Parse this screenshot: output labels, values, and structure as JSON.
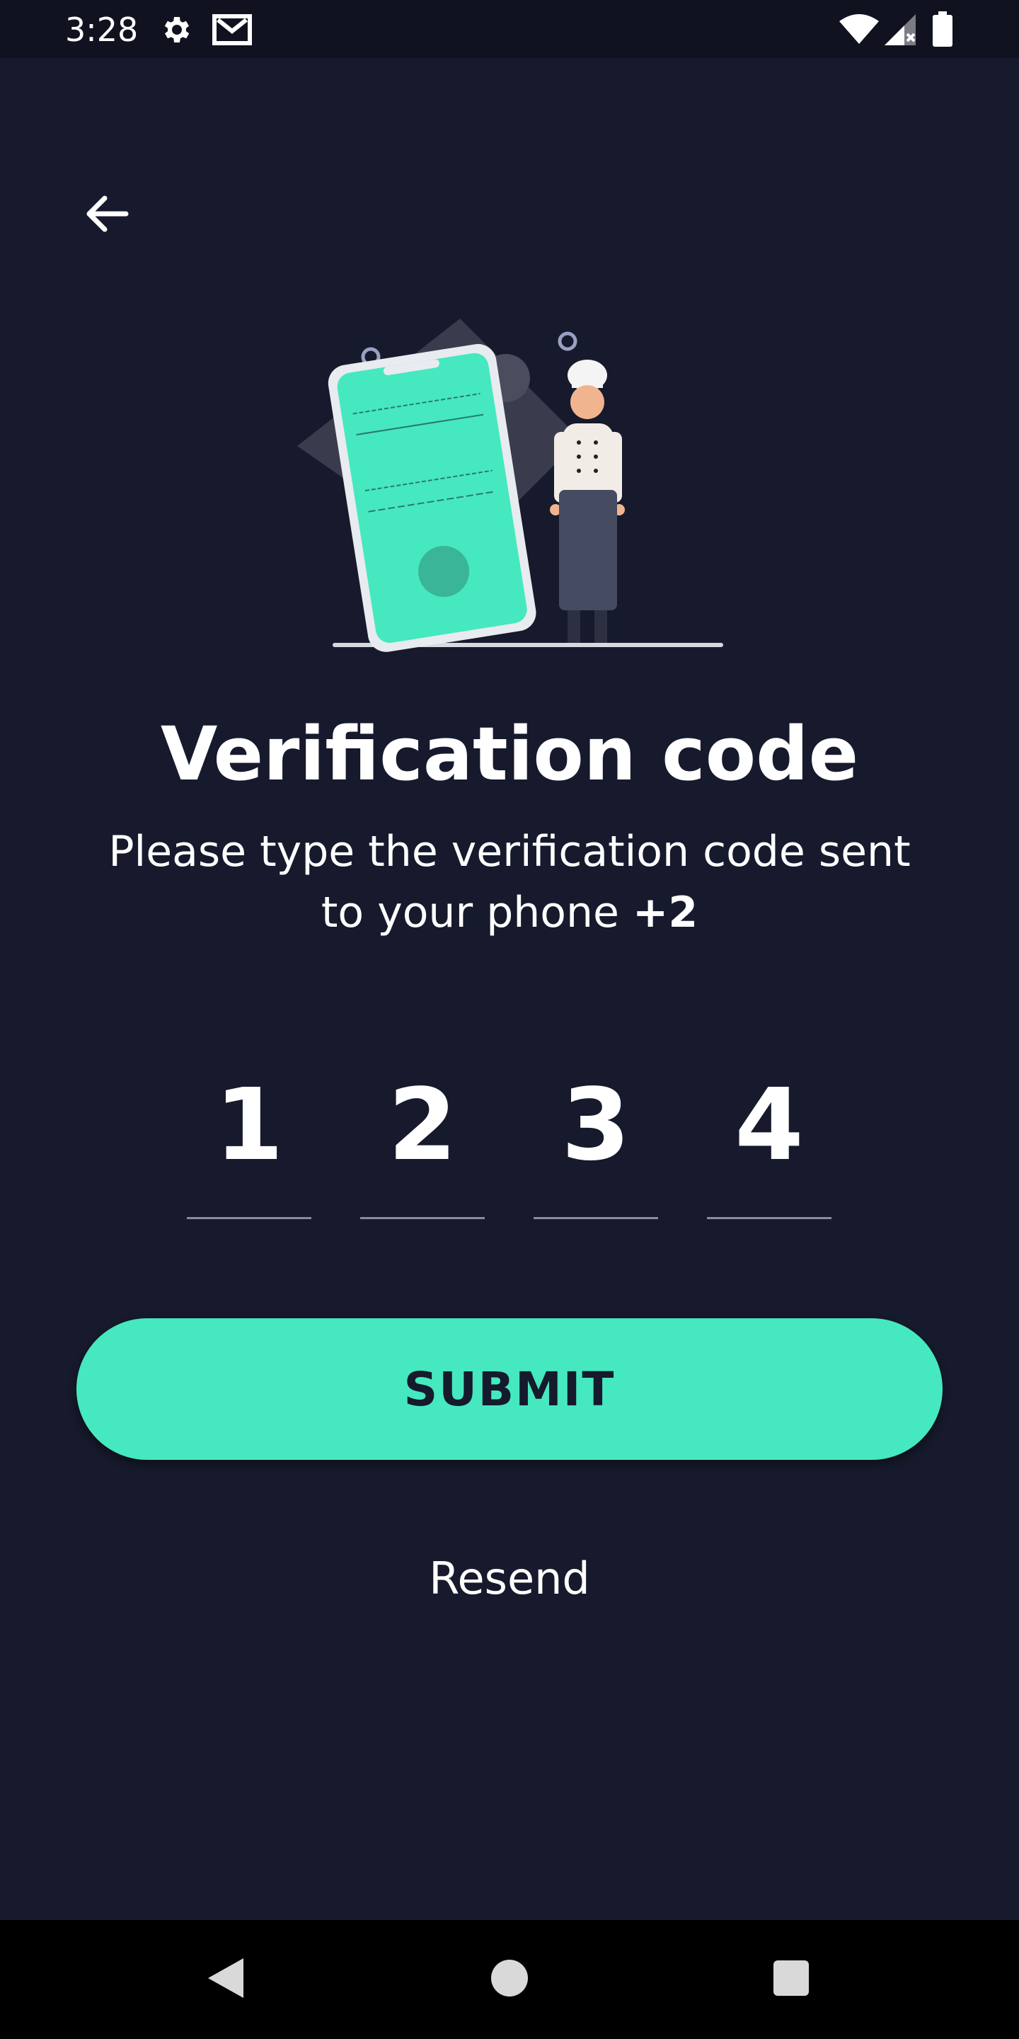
{
  "status_bar": {
    "time": "3:28",
    "icons": [
      "gear-icon",
      "gmail-icon",
      "wifi-icon",
      "signal-icon",
      "battery-icon"
    ]
  },
  "header": {
    "back_icon": "arrow-left-icon"
  },
  "main": {
    "title": "Verification code",
    "subtitle_text": "Please type the verification code sent to your phone ",
    "subtitle_phone": "+2",
    "code_digits": [
      "1",
      "2",
      "3",
      "4"
    ],
    "submit_label": "SUBMIT",
    "resend_label": "Resend"
  },
  "nav_bar": {
    "icons": [
      "back-triangle-icon",
      "home-circle-icon",
      "recents-square-icon"
    ]
  },
  "colors": {
    "background": "#161a2c",
    "accent": "#46e8c0",
    "status_bar": "#10131f"
  }
}
